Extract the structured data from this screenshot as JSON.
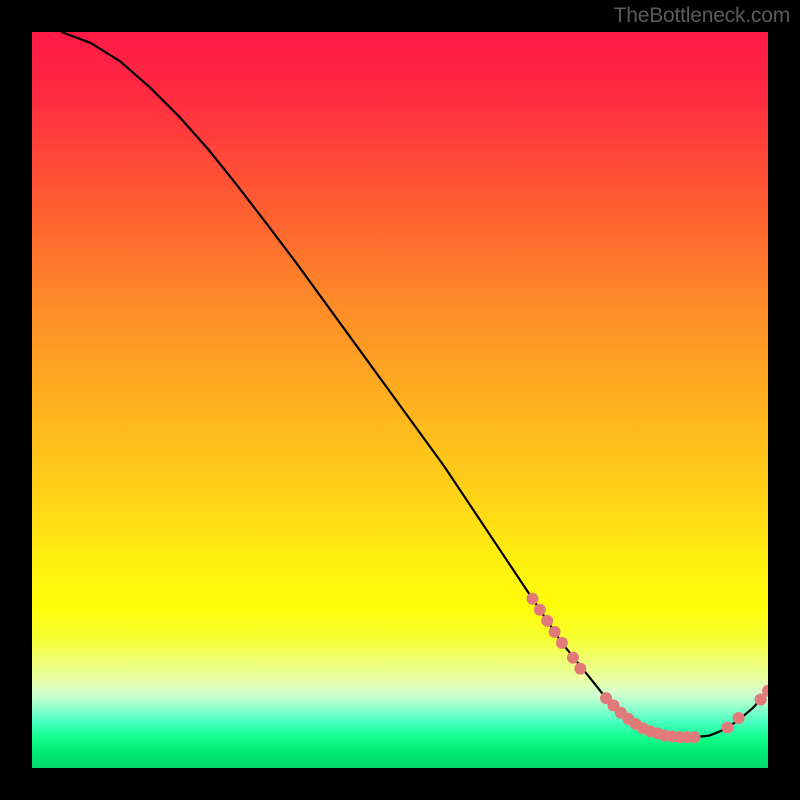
{
  "watermark": "TheBottleneck.com",
  "chart_data": {
    "type": "line",
    "title": "",
    "xlabel": "",
    "ylabel": "",
    "xlim": [
      0,
      100
    ],
    "ylim": [
      0,
      100
    ],
    "series": [
      {
        "name": "main-curve",
        "x": [
          4,
          8,
          12,
          16,
          20,
          24,
          28,
          32,
          36,
          40,
          44,
          48,
          52,
          56,
          60,
          64,
          68,
          72,
          74,
          76,
          78,
          80,
          82,
          84,
          86,
          88,
          90,
          92,
          94,
          96,
          98,
          100
        ],
        "y": [
          100,
          98.5,
          96,
          92.5,
          88.5,
          84,
          79,
          73.8,
          68.5,
          63,
          57.5,
          52,
          46.5,
          41,
          35,
          29,
          23,
          17,
          14.5,
          12,
          9.5,
          7.5,
          6,
          5,
          4.4,
          4.2,
          4.2,
          4.4,
          5.2,
          6.5,
          8.2,
          10.5
        ]
      }
    ],
    "markers": [
      {
        "name": "cluster-left",
        "points": [
          {
            "x": 68,
            "y": 23
          },
          {
            "x": 69,
            "y": 21.5
          },
          {
            "x": 70,
            "y": 20
          },
          {
            "x": 71,
            "y": 18.5
          },
          {
            "x": 72,
            "y": 17
          },
          {
            "x": 73.5,
            "y": 15
          },
          {
            "x": 74.5,
            "y": 13.5
          }
        ]
      },
      {
        "name": "cluster-bottom",
        "points": [
          {
            "x": 78,
            "y": 9.5
          },
          {
            "x": 79,
            "y": 8.5
          },
          {
            "x": 80,
            "y": 7.5
          },
          {
            "x": 81,
            "y": 6.7
          },
          {
            "x": 82,
            "y": 6
          },
          {
            "x": 83,
            "y": 5.4
          },
          {
            "x": 84,
            "y": 5
          },
          {
            "x": 85,
            "y": 4.7
          },
          {
            "x": 86,
            "y": 4.4
          },
          {
            "x": 87,
            "y": 4.3
          },
          {
            "x": 88,
            "y": 4.2
          },
          {
            "x": 89,
            "y": 4.2
          },
          {
            "x": 90,
            "y": 4.2
          }
        ]
      },
      {
        "name": "cluster-right",
        "points": [
          {
            "x": 94.5,
            "y": 5.5
          },
          {
            "x": 96,
            "y": 6.8
          }
        ]
      },
      {
        "name": "end-points",
        "points": [
          {
            "x": 99,
            "y": 9.3
          },
          {
            "x": 100,
            "y": 10.5
          }
        ]
      }
    ],
    "marker_color": "#e37a7a",
    "marker_radius": 6,
    "curve_color": "#000000",
    "gradient_stops": [
      {
        "pos": 0.0,
        "color": "#ff1a47"
      },
      {
        "pos": 0.22,
        "color": "#ff5833"
      },
      {
        "pos": 0.5,
        "color": "#ffb020"
      },
      {
        "pos": 0.72,
        "color": "#fff010"
      },
      {
        "pos": 0.88,
        "color": "#e8ffa8"
      },
      {
        "pos": 0.94,
        "color": "#40ffbb"
      },
      {
        "pos": 1.0,
        "color": "#00d868"
      }
    ]
  }
}
